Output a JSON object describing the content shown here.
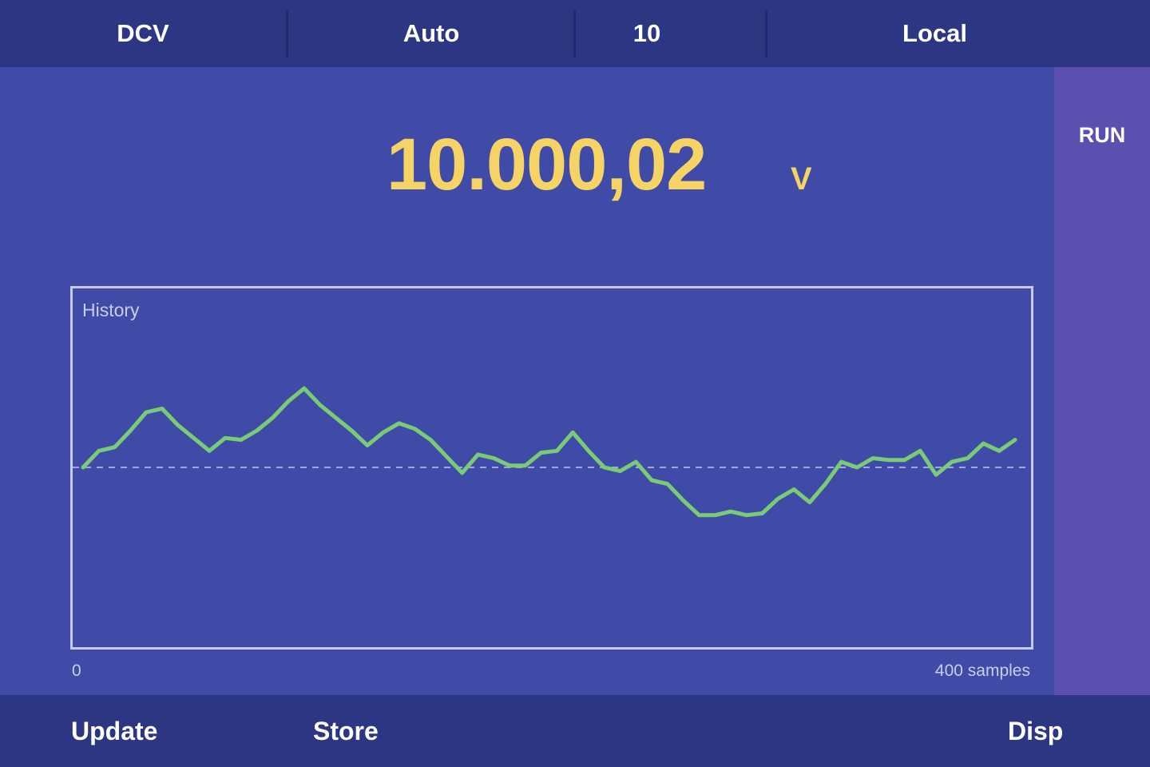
{
  "top_bar": {
    "function": "DCV",
    "range": "Auto",
    "nplc": "10",
    "mode": "Local"
  },
  "side_bar": {
    "status": "RUN"
  },
  "readout": {
    "value": "10.000,02",
    "unit": "V"
  },
  "history": {
    "title": "History",
    "x_start_label": "0",
    "x_end_label": "400 samples"
  },
  "softkeys": {
    "update": "Update",
    "store": "Store",
    "disp": "Disp"
  },
  "colors": {
    "trace": "#7ACB75",
    "reading": "#F6D365",
    "baseline": "#9FA8E0"
  },
  "chart_data": {
    "type": "line",
    "x_range": [
      0,
      400
    ],
    "baseline": 0,
    "y_range": [
      -1,
      1
    ],
    "values": [
      0.0,
      0.09,
      0.11,
      0.2,
      0.3,
      0.32,
      0.23,
      0.16,
      0.09,
      0.16,
      0.15,
      0.2,
      0.27,
      0.36,
      0.43,
      0.34,
      0.27,
      0.2,
      0.12,
      0.19,
      0.24,
      0.21,
      0.15,
      0.06,
      -0.03,
      0.07,
      0.05,
      0.01,
      0.01,
      0.08,
      0.09,
      0.19,
      0.09,
      0.0,
      -0.02,
      0.03,
      -0.07,
      -0.09,
      -0.18,
      -0.26,
      -0.26,
      -0.24,
      -0.26,
      -0.25,
      -0.17,
      -0.12,
      -0.19,
      -0.09,
      0.03,
      0.0,
      0.05,
      0.04,
      0.04,
      0.09,
      -0.04,
      0.03,
      0.05,
      0.13,
      0.09,
      0.15
    ]
  }
}
